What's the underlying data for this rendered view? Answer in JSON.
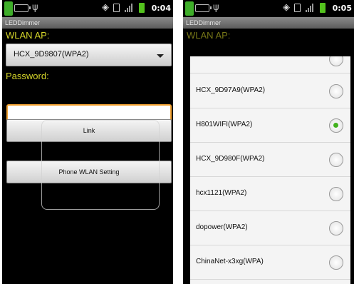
{
  "left": {
    "time": "0:04",
    "app_title": "LEDDimmer",
    "wlan_label": "WLAN AP:",
    "wlan_value": "HCX_9D9807(WPA2)",
    "password_label": "Password:",
    "password_value": "",
    "link_button": "Link",
    "phone_wlan_button": "Phone WLAN Setting"
  },
  "right": {
    "time": "0:05",
    "app_title": "LEDDimmer",
    "wlan_label": "WLAN AP:",
    "networks": [
      {
        "name": "HCX_9D97A9(WPA2)",
        "selected": false
      },
      {
        "name": "H801WIFI(WPA2)",
        "selected": true
      },
      {
        "name": "HCX_9D980F(WPA2)",
        "selected": false
      },
      {
        "name": "hcx1121(WPA2)",
        "selected": false
      },
      {
        "name": "dopower(WPA2)",
        "selected": false
      },
      {
        "name": "ChinaNet-x3xg(WPA)",
        "selected": false
      }
    ]
  },
  "colors": {
    "label": "#d5d52a",
    "radio_selected": "#41b11c",
    "focus_border": "#f0a030"
  }
}
